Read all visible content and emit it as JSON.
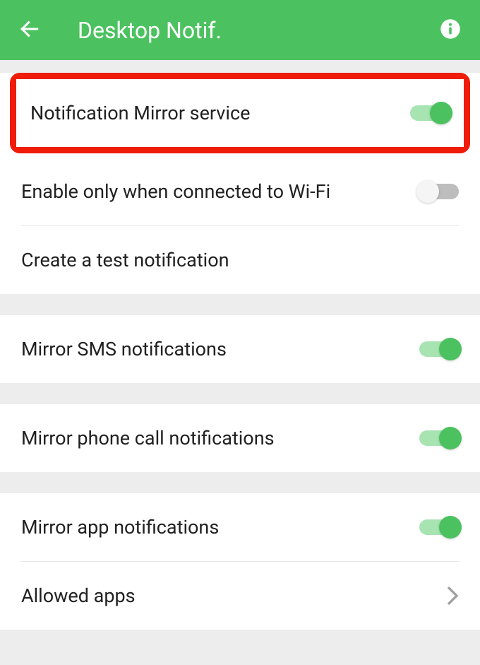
{
  "header": {
    "title": "Desktop Notif."
  },
  "settings": {
    "mirror_service": {
      "label": "Notification Mirror service",
      "enabled": true
    },
    "wifi_only": {
      "label": "Enable only when connected to Wi-Fi",
      "enabled": false
    },
    "test_notif": {
      "label": "Create a test notification"
    },
    "mirror_sms": {
      "label": "Mirror SMS notifications",
      "enabled": true
    },
    "mirror_calls": {
      "label": "Mirror phone call notifications",
      "enabled": true
    },
    "mirror_apps": {
      "label": "Mirror app notifications",
      "enabled": true
    },
    "allowed_apps": {
      "label": "Allowed apps"
    }
  }
}
